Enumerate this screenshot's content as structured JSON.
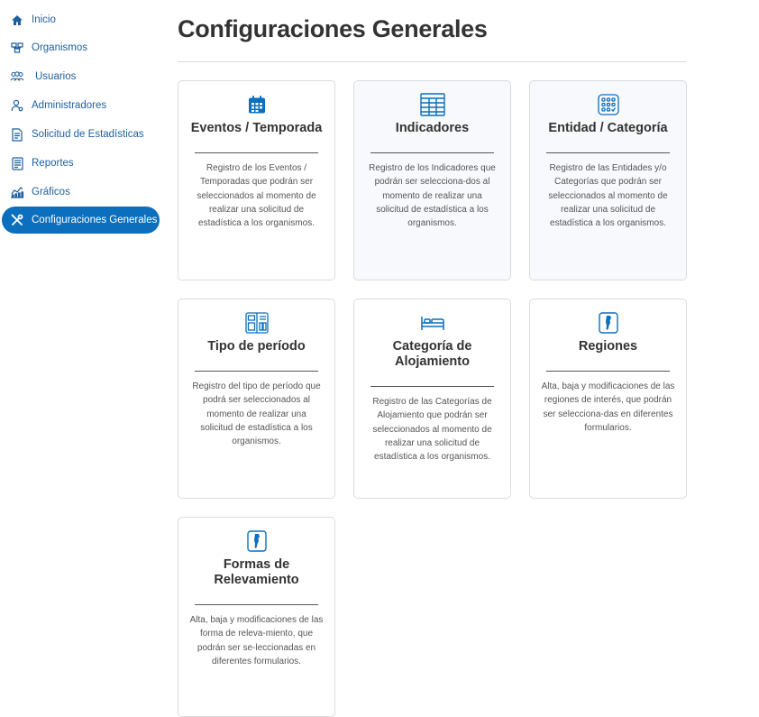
{
  "sidebar": {
    "items": [
      {
        "label": "Inicio",
        "icon": "home-icon"
      },
      {
        "label": "Organismos",
        "icon": "organizations-icon"
      },
      {
        "label": "Usuarios",
        "icon": "users-icon"
      },
      {
        "label": "Administradores",
        "icon": "admin-icon"
      },
      {
        "label": "Solicitud de Estadísticas",
        "icon": "request-document-icon"
      },
      {
        "label": "Reportes",
        "icon": "report-icon"
      },
      {
        "label": "Gráficos",
        "icon": "chart-icon"
      },
      {
        "label": "Configuraciones Generales",
        "icon": "tools-icon",
        "active": true
      }
    ]
  },
  "page": {
    "title": "Configuraciones Generales"
  },
  "cards": [
    {
      "icon": "calendar-icon",
      "title": "Eventos / Temporada",
      "description": "Registro de los Eventos / Temporadas que podrán ser seleccionados al momento de realizar una solicitud de estadística a los organismos."
    },
    {
      "icon": "table-icon",
      "title": "Indicadores",
      "description": "Registro de los Indicadores que podrán ser selecciona-dos al momento de realizar una solicitud de estadística a los organismos."
    },
    {
      "icon": "grid-category-icon",
      "title": "Entidad / Categoría",
      "description": "Registro de las Entidades y/o Categorías que podrán ser seleccionados al momento de realizar una solicitud de estadística a los organismos."
    },
    {
      "icon": "period-icon",
      "title": "Tipo de período",
      "description": "Registro del tipo de período que podrá ser seleccionados al momento de realizar una solicitud de estadística a los organismos."
    },
    {
      "icon": "bed-icon",
      "title": "Categoría de Alojamiento",
      "description": "Registro de las Categorías de Alojamiento que podrán ser seleccionados al momento de realizar una solicitud de estadística a los organismos."
    },
    {
      "icon": "map-argentina-icon",
      "title": "Regiones",
      "description": "Alta, baja y modificaciones de las regiones de interés, que podrán ser selecciona-das en diferentes formularios."
    },
    {
      "icon": "map-argentina-icon",
      "title": "Formas de Relevamiento",
      "description": "Alta, baja y modificaciones de las forma de releva-miento, que podrán ser se-leccionadas en diferentes formularios."
    }
  ],
  "colors": {
    "accent": "#0b6fbd",
    "nav_text": "#1f5f9e",
    "card_border": "#dcdcdc"
  }
}
